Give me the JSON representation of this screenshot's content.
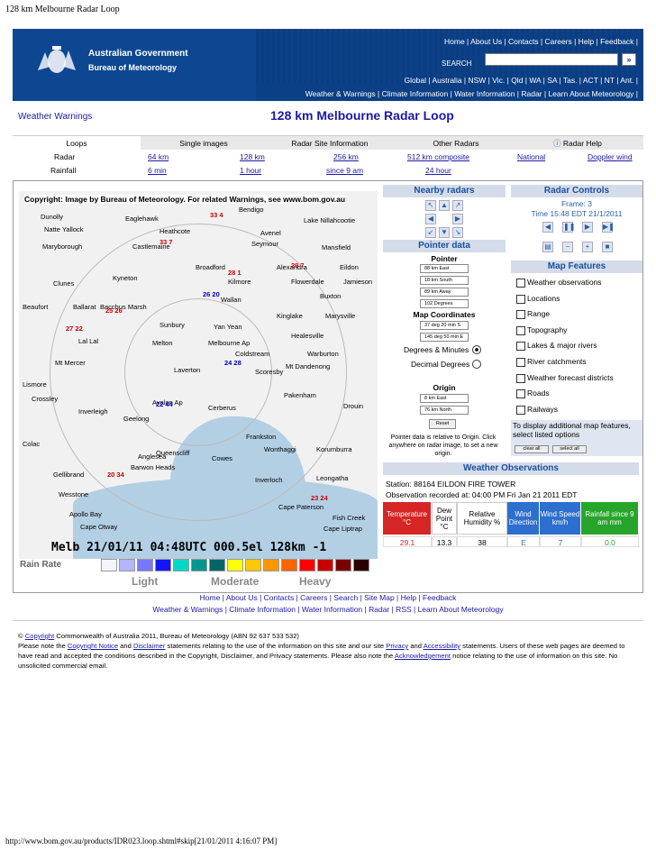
{
  "print_title": "128 km Melbourne Radar Loop",
  "print_footer": "http://www.bom.gov.au/products/IDR023.loop.shtml#skip[21/01/2011 4:16:07 PM]",
  "header": {
    "gov_line1": "Australian Government",
    "gov_line2": "Bureau of Meteorology",
    "top_links": "Home | About Us | Contacts | Careers | Help | Feedback |",
    "search_label": "SEARCH",
    "search_button": "»",
    "state_links": "Global | Australia | NSW | Vic. | Qld | WA | SA | Tas. | ACT | NT | Ant. |",
    "main_nav": "Weather & Warnings | Climate Information | Water Information | Radar | Learn About Meteorology |"
  },
  "weather_warnings": "Weather Warnings",
  "page_title": "128 km Melbourne Radar Loop",
  "tabs": [
    "Loops",
    "Single images",
    "Radar Site Information",
    "Other Radars",
    "Radar Help"
  ],
  "radar_row": {
    "label": "Radar",
    "links": [
      "64 km",
      "128 km",
      "256 km",
      "512 km composite",
      "National",
      "Doppler wind"
    ]
  },
  "rainfall_row": {
    "label": "Rainfall",
    "links": [
      "6 min",
      "1 hour",
      "since 9 am",
      "24 hour"
    ]
  },
  "radar_image": {
    "caption": "Copyright: Image by Bureau of Meteorology. For related Warnings, see www.bom.gov.au",
    "stamp": "Melb    21/01/11 04:48UTC 000.5el 128km -1",
    "places": [
      "Dunolly",
      "Eaglehawk",
      "Bendigo",
      "Natte Yallock",
      "Heathcote",
      "Avenel",
      "Lake Nillahcootie",
      "Maryborough",
      "Castlemaine",
      "Seymour",
      "Mansfield",
      "Broadford",
      "Alexandra",
      "Eildon",
      "Clunes",
      "Kyneton",
      "Kilmore",
      "Flowerdale",
      "Jamieson",
      "Ballarat",
      "Bacchus Marsh",
      "Wallan",
      "Buxton",
      "Beaufort",
      "Melton",
      "Kinglake",
      "Marysville",
      "Lal Lal",
      "Sunbury",
      "Yan Yean",
      "Healesville",
      "Mt Mercer",
      "Melbourne Ap",
      "Coldstream",
      "Warburton",
      "Lismore",
      "Laverton",
      "Scoresby",
      "Mt Dandenong",
      "Crossley",
      "Avalon Ap",
      "Cerberus",
      "Pakenham",
      "Inverleigh",
      "Geelong",
      "Frankston",
      "Drouin",
      "Colac",
      "Queenscliff",
      "Wonthaggi",
      "Anglesea",
      "Korumburra",
      "Barwon Heads",
      "Cowes",
      "Gellibrand",
      "Inverloch",
      "Leongatha",
      "Wesstone",
      "Cape Paterson",
      "Apollo Bay",
      "Cape Otway",
      "Cape Liptrap",
      "Fish Creek"
    ],
    "obs_values": [
      "33 4",
      "33 7",
      "29 7",
      "26 20",
      "28 1",
      "27 22",
      "25 26",
      "24 28",
      "23 24",
      "22 44",
      "20 34"
    ]
  },
  "rain_rate": {
    "label": "Rain Rate",
    "colors": [
      "#f5f5ff",
      "#b4b4ff",
      "#7878ff",
      "#1414ff",
      "#00d8c3",
      "#009690",
      "#006666",
      "#ffff00",
      "#ffc800",
      "#ff9600",
      "#ff6400",
      "#ff0000",
      "#c80000",
      "#780000",
      "#280000"
    ],
    "levels": [
      "Light",
      "Moderate",
      "Heavy"
    ]
  },
  "nearby_radars": {
    "title": "Nearby radars"
  },
  "radar_controls": {
    "title": "Radar Controls",
    "frame": "Frame: 3",
    "time": "Time 15:48 EDT 21/1/2011"
  },
  "pointer_data": {
    "title": "Pointer data",
    "pointer_label": "Pointer",
    "pointer_values": [
      "88 km East",
      "18 km South",
      "89 km Away",
      "102 Degrees"
    ],
    "map_coords_label": "Map Coordinates",
    "map_coords": [
      "37 deg 20 min S",
      "145 deg 50 min E"
    ],
    "deg_minutes": "Degrees & Minutes",
    "decimal_degrees": "Decimal Degrees",
    "origin_label": "Origin",
    "origin_values": [
      "8 km East",
      "76 km North"
    ],
    "reset": "Reset",
    "note": "Pointer data is relative to Origin. Click anywhere on radar image, to set a new origin."
  },
  "map_features": {
    "title": "Map Features",
    "items": [
      "Weather observations",
      "Locations",
      "Range",
      "Topography",
      "Lakes & major rivers",
      "River catchments",
      "Weather forecast districts",
      "Roads",
      "Railways"
    ],
    "note": "To display additional map features, select listed options",
    "clear_all": "clear all",
    "select_all": "select all"
  },
  "weather_observations": {
    "title": "Weather Observations",
    "station": "Station: 88164 EILDON FIRE TOWER",
    "recorded": "Observation recorded at: 04:00 PM Fri Jan 21 2011 EDT",
    "headers": [
      "Temperature °C",
      "Dew Point °C",
      "Relative Humidity %",
      "Wind Direction",
      "Wind Speed km/h",
      "Rainfall since 9 am mm"
    ],
    "values": [
      "29.1",
      "13.3",
      "38",
      "E",
      "7",
      "0.0"
    ]
  },
  "footer": {
    "links1": "Home | About Us | Contacts | Careers | Search | Site Map | Help | Feedback",
    "links2": "Weather & Warnings | Climate Information | Water Information | Radar | RSS | Learn About Meteorology",
    "copy_symbol": "©",
    "copyright_link": "Copyright",
    "copyright_text": "Commonwealth of Australia 2011, Bureau of Meteorology (ABN 92 637 533 532)",
    "note_prefix": "Please note the",
    "copyright_notice": "Copyright Notice",
    "and1": "and",
    "disclaimer": "Disclaimer",
    "note_mid": "statements relating to the use of the information on this site and our site",
    "privacy": "Privacy",
    "and2": "and",
    "accessibility": "Accessibility",
    "note_mid2": "statements. Users of these web pages are deemed to have read and accepted the conditions described in the Copyright, Disclaimer, and Privacy statements. Please also note the",
    "acknowledgement": "Acknowledgement",
    "note_end": "notice relating to the use of information on this site. No unsolicited commercial email."
  }
}
